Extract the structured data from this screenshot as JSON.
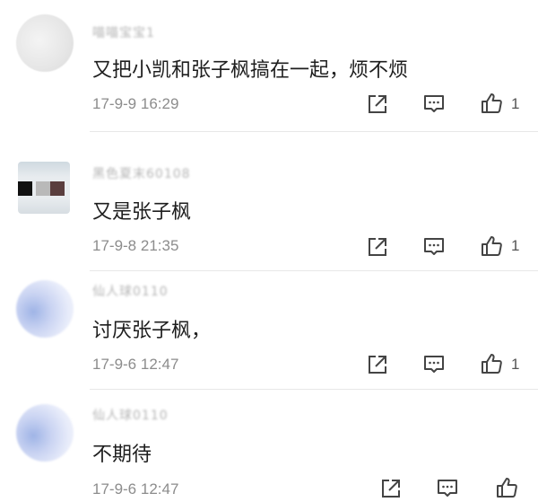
{
  "comments": [
    {
      "username": "喵喵宝宝1",
      "text": "又把小凯和张子枫搞在一起，烦不烦",
      "time": "17-9-9 16:29",
      "likes": "1"
    },
    {
      "username": "黑色夏末60108",
      "text": "又是张子枫",
      "time": "17-9-8 21:35",
      "likes": "1"
    },
    {
      "username": "仙人球0110",
      "text": "讨厌张子枫，",
      "time": "17-9-6 12:47",
      "likes": "1"
    },
    {
      "username": "仙人球0110",
      "text": "不期待",
      "time": "17-9-6 12:47",
      "likes": ""
    }
  ],
  "icons": {
    "share": "share-icon",
    "reply": "comment-icon",
    "like": "thumbs-up-icon"
  },
  "colors": {
    "text": "#1e1e1e",
    "meta": "#8c8c8c",
    "icon": "#444444"
  }
}
